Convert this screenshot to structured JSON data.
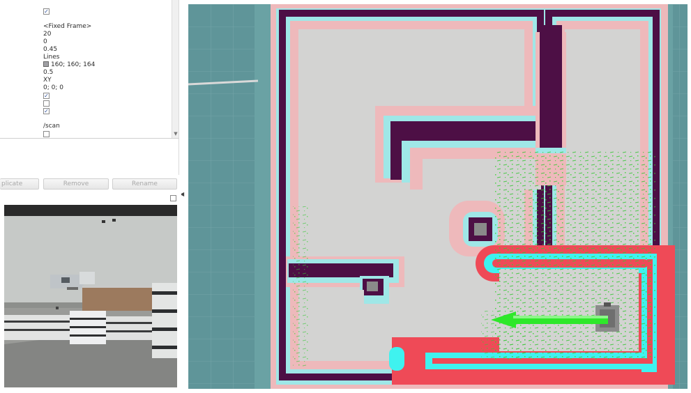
{
  "properties": {
    "values": [
      {
        "type": "checkbox",
        "checked": true
      },
      {
        "type": "text",
        "text": "<Fixed Frame>"
      },
      {
        "type": "text",
        "text": "20"
      },
      {
        "type": "text",
        "text": "0"
      },
      {
        "type": "text",
        "text": "0.45"
      },
      {
        "type": "text",
        "text": "Lines"
      },
      {
        "type": "color",
        "text": "160; 160; 164",
        "color": "#a0a0a4"
      },
      {
        "type": "text",
        "text": "0.5"
      },
      {
        "type": "text",
        "text": "XY"
      },
      {
        "type": "text",
        "text": "0; 0; 0"
      },
      {
        "type": "checkbox",
        "checked": true
      },
      {
        "type": "checkbox",
        "checked": false
      },
      {
        "type": "checkbox",
        "checked": true
      },
      {
        "type": "text",
        "text": "/scan"
      },
      {
        "type": "checkbox",
        "checked": false
      }
    ]
  },
  "buttons": {
    "duplicate": "plicate",
    "remove": "Remove",
    "rename": "Rename"
  },
  "colors": {
    "map_background": "#5f9599",
    "free_space": "#d3d3d2",
    "obstacle": "#4d0f45",
    "inflation_cyan": "#9fe7e7",
    "inflation_pink": "#eeb9bb",
    "local_costmap_red": "#ef4a57",
    "local_costmap_cyan": "#3ff2ef",
    "laser_points": "#3ed13a",
    "goal_arrow": "#2ee82a"
  },
  "icons": {
    "collapse": "triangle-left-icon"
  }
}
